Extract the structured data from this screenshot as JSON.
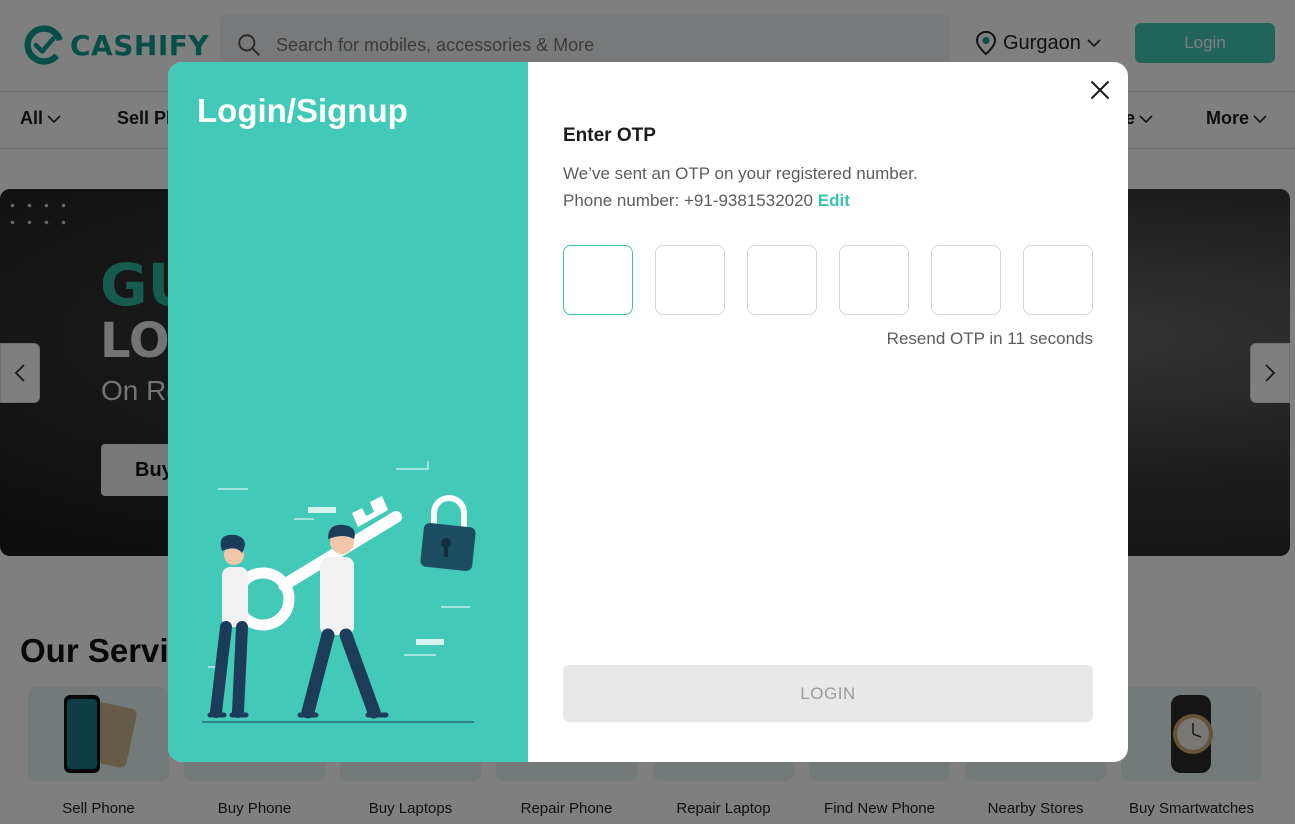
{
  "header": {
    "logo_text": "CASHIFY",
    "search_placeholder": "Search for mobiles, accessories & More",
    "location": "Gurgaon",
    "login_label": "Login"
  },
  "nav": {
    "items": [
      "All",
      "Sell Ph",
      "e",
      "More"
    ]
  },
  "banner": {
    "heading_1": "GU",
    "heading_2": "LO",
    "subheading": "On Re",
    "button_label": "Buy"
  },
  "services": {
    "title": "Our Servi",
    "items": [
      {
        "label": "Sell Phone"
      },
      {
        "label": "Buy Phone"
      },
      {
        "label": "Buy Laptops"
      },
      {
        "label": "Repair Phone"
      },
      {
        "label": "Repair Laptop"
      },
      {
        "label": "Find New Phone"
      },
      {
        "label": "Nearby Stores"
      },
      {
        "label": "Buy Smartwatches"
      }
    ]
  },
  "modal": {
    "left_title": "Login/Signup",
    "otp_title": "Enter OTP",
    "otp_message": "We’ve sent an OTP on your registered number.",
    "phone_prefix": "Phone number: +91-9381532020",
    "edit_label": "Edit",
    "otp_digits": [
      "",
      "",
      "",
      "",
      "",
      ""
    ],
    "resend_text": "Resend OTP in 11 seconds",
    "login_button": "LOGIN"
  },
  "colors": {
    "brand_teal": "#43c9b7",
    "accent_link": "#3cc1ad",
    "login_disabled_bg": "#e8e8e8"
  }
}
